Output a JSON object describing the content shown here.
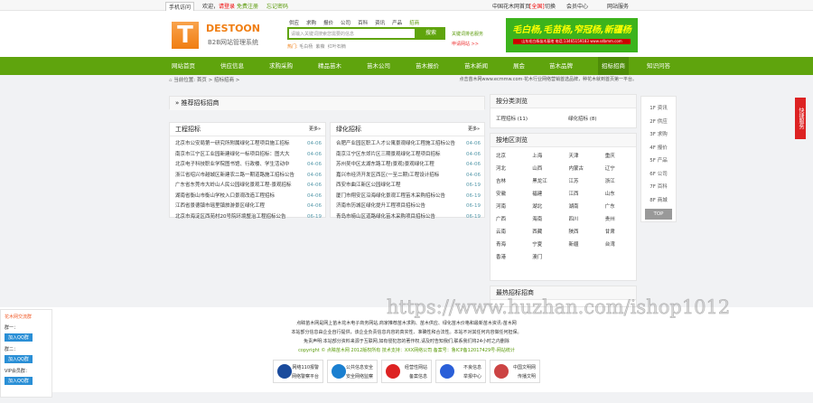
{
  "topbar": {
    "mobile": "手机访问",
    "welcome": "欢迎，",
    "login": "请登录",
    "register": "免费注册",
    "forgot": "忘记密码",
    "site": "中国花木网首页",
    "city": "[全国]",
    "switch": "切换",
    "member": "会员中心",
    "service": "网站服务"
  },
  "header": {
    "logo": "DESTOON",
    "logo_sub": "B2B网站管理系统",
    "search_tabs": [
      "供应",
      "求购",
      "报价",
      "公司",
      "百科",
      "资讯",
      "产品",
      "招商"
    ],
    "search_placeholder": "请输入关键词搜索您需要的信息",
    "search_button": "搜索",
    "hot_label": "热门:",
    "hot": [
      "毛白杨",
      "紫薇",
      "红叶石楠"
    ],
    "side_links": [
      "关键词排名服务",
      "申请网站 >>"
    ],
    "banner_text": "毛白杨,毛苗杨,窄冠杨,新疆杨",
    "banner_sub": "山东毛白杨苗木基地 电话:13465159183 www.sdbmm.com"
  },
  "nav": [
    "网站首页",
    "供应信息",
    "求购采购",
    "精品苗木",
    "苗木公司",
    "苗木报价",
    "苗木新闻",
    "展会",
    "苗木品牌",
    "招标招商",
    "知识问答"
  ],
  "breadcrumb": {
    "label": "当前位置:",
    "home": "首页",
    "current": "招标招商 >",
    "notice": "点击苗木网www.ecmmw.com·花木行业网络营销首选品牌，种花木就到首页第一平台。"
  },
  "featured": {
    "title": "» 推荐招标招商"
  },
  "engineering": {
    "title": "工程招标",
    "more": "更多»",
    "items": [
      [
        "北京市公安局第一研究所附属绿化工程项目施工招标",
        "04-06"
      ],
      [
        "南京市江宁区工业园新建绿化一标项目招标：图大大",
        "04-06"
      ],
      [
        "北京电子科技职业学院图书馆、行政楼、学生活动中",
        "04-06"
      ],
      [
        "浙江省绍兴市越城区新建农二路一期道路施工招标公告",
        "04-06"
      ],
      [
        "广东省东莞市大岭山人民公园绿化景观工程-景观招标",
        "04-06"
      ],
      [
        "湖南省衡山市衡山学校入口景观改造工程招标",
        "04-06"
      ],
      [
        "江西省景德镇市瑶里镇旅游景区绿化工程",
        "04-06"
      ],
      [
        "北京市海淀区西苑村20号院环境整治工程招标公告",
        "06-19"
      ]
    ]
  },
  "greening": {
    "title": "绿化招标",
    "more": "更多»",
    "items": [
      [
        "合肥产业园区职工人才公寓景观绿化工程施工招标公告",
        "04-06"
      ],
      [
        "南京江宁区东郊片区三期景观绿化工程项目招标",
        "04-06"
      ],
      [
        "苏州吴中区太湖东路工程(景观)景观绿化工程",
        "04-06"
      ],
      [
        "嘉兴市经济开发区西区(一至二期)工程设计招标",
        "04-06"
      ],
      [
        "西安市曲江新区公园绿化工程",
        "06-19"
      ],
      [
        "厦门市翔安区沿海绿化景观工程苗木采购招标公告",
        "06-19"
      ],
      [
        "济南市历城区绿化提升工程项目招标公告",
        "06-19"
      ],
      [
        "青岛市崂山区道路绿化苗木采购项目招标公告",
        "06-19"
      ]
    ]
  },
  "by_category": {
    "title": "按分类浏览",
    "items": [
      "工程招标 (11)",
      "绿化招标 (8)"
    ]
  },
  "by_region": {
    "title": "按地区浏览",
    "items": [
      "北京",
      "上海",
      "天津",
      "重庆",
      "河北",
      "山西",
      "内蒙古",
      "辽宁",
      "吉林",
      "黑龙江",
      "江苏",
      "浙江",
      "安徽",
      "福建",
      "江西",
      "山东",
      "河南",
      "湖北",
      "湖南",
      "广东",
      "广西",
      "海南",
      "四川",
      "贵州",
      "云南",
      "西藏",
      "陕西",
      "甘肃",
      "青海",
      "宁夏",
      "新疆",
      "台湾",
      "香港",
      "澳门"
    ]
  },
  "hot_recommend": {
    "title": "最热招标招商"
  },
  "floors": [
    "1F 资讯",
    "2F 供应",
    "3F 求购",
    "4F 报价",
    "5F 产品",
    "6F 公司",
    "7F 百科",
    "8F 商城"
  ],
  "top_button": "TOP",
  "quick_tab": "快捷服务",
  "watermark": "https://www.huzhan.com/ishop1012",
  "qq": {
    "title": "花木网交流群",
    "groups": [
      "群一：",
      "群二：",
      "VIP会员群："
    ],
    "join": "加入QQ群"
  },
  "footer": {
    "lines": [
      "点睛苗木网是网上苗木花木电子商务网站,商家推荐苗木求购、苗木供应、绿化苗木价格和最新苗木资讯-苗木网",
      "本站部分信息由企业自行提供，该企业负责信息内容的真实性、准确性和合法性。本站不对其任何内容做任何担保。",
      "免责声明:本站部分资料来源于互联网,如有侵犯您的著作权,请及时告知我们,联系我们将24小时之内删除",
      "copyright © 点睛苗木网 2012版权所有  技术支持：XXX网络公司 备案号：鲁ICP备12017429号-网站统计"
    ],
    "badges": [
      [
        "网络110报警",
        "网络警察平台"
      ],
      [
        "公共信息安全",
        "安全网络监察"
      ],
      [
        "经营性网站",
        "备案信息"
      ],
      [
        "不良信息",
        "举报中心"
      ],
      [
        "中国文明网",
        "传播文明"
      ]
    ]
  }
}
